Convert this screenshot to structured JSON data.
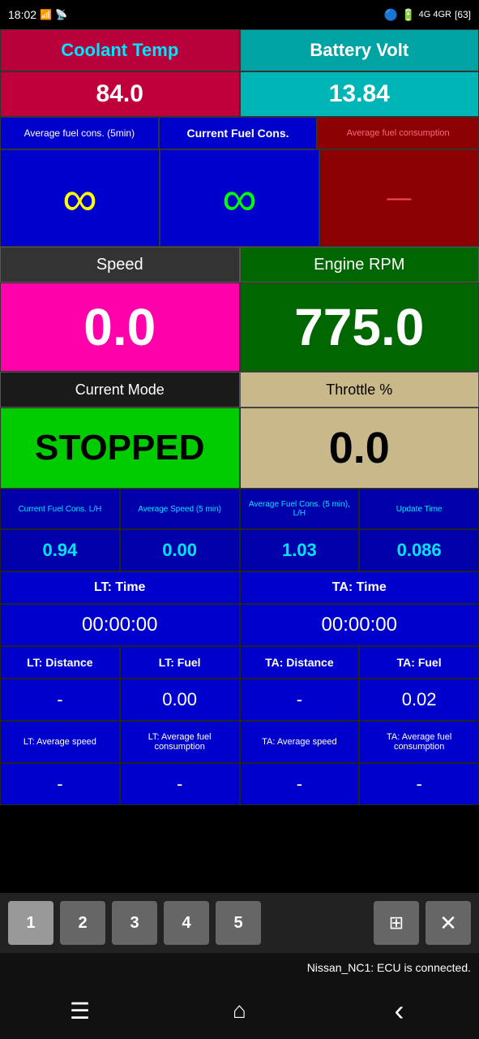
{
  "statusBar": {
    "time": "18:02",
    "icons": "status icons"
  },
  "row1": {
    "coolantTempLabel": "Coolant Temp",
    "batteryVoltLabel": "Battery Volt"
  },
  "row2": {
    "coolantTempValue": "84.0",
    "batteryVoltValue": "13.84"
  },
  "row3": {
    "avgFuelLabel": "Average fuel cons. (5min)",
    "currentFuelLabel": "Current Fuel Cons.",
    "avgFuelConsLabel": "Average fuel consumption"
  },
  "row4": {
    "inf1": "∞",
    "inf2": "∞",
    "dash": "—"
  },
  "row5": {
    "speedLabel": "Speed",
    "rpmLabel": "Engine RPM"
  },
  "row6": {
    "speedValue": "0.0",
    "rpmValue": "775.0"
  },
  "row7": {
    "modeLabel": "Current Mode",
    "throttleLabel": "Throttle %"
  },
  "row8": {
    "modeValue": "STOPPED",
    "throttleValue": "0.0"
  },
  "row9": {
    "stat1Label": "Current Fuel Cons. L/H",
    "stat2Label": "Average Speed (5 min)",
    "stat3Label": "Average Fuel Cons. (5 min), L/H",
    "stat4Label": "Update Time"
  },
  "row10": {
    "stat1Value": "0.94",
    "stat2Value": "0.00",
    "stat3Value": "1.03",
    "stat4Value": "0.086"
  },
  "row11": {
    "ltTimeLabel": "LT: Time",
    "taTimeLabel": "TA: Time"
  },
  "row12": {
    "ltTimeValue": "00:00:00",
    "taTimeValue": "00:00:00"
  },
  "row13": {
    "ltDistLabel": "LT: Distance",
    "ltFuelLabel": "LT: Fuel",
    "taDistLabel": "TA: Distance",
    "taFuelLabel": "TA: Fuel"
  },
  "row14": {
    "ltDistValue": "-",
    "ltFuelValue": "0.00",
    "taDistValue": "-",
    "taFuelValue": "0.02"
  },
  "row15": {
    "ltAvgSpeedLabel": "LT: Average speed",
    "ltAvgFuelLabel": "LT: Average fuel consumption",
    "taAvgSpeedLabel": "TA: Average speed",
    "taAvgFuelLabel": "TA: Average fuel consumption"
  },
  "row16": {
    "ltAvgSpeedValue": "-",
    "ltAvgFuelValue": "-",
    "taAvgSpeedValue": "-",
    "taAvgFuelValue": "-"
  },
  "toolbar": {
    "tab1": "1",
    "tab2": "2",
    "tab3": "3",
    "tab4": "4",
    "tab5": "5"
  },
  "statusMsg": "Nissan_NC1: ECU is connected.",
  "nav": {
    "menu": "☰",
    "home": "⌂",
    "back": "‹"
  }
}
